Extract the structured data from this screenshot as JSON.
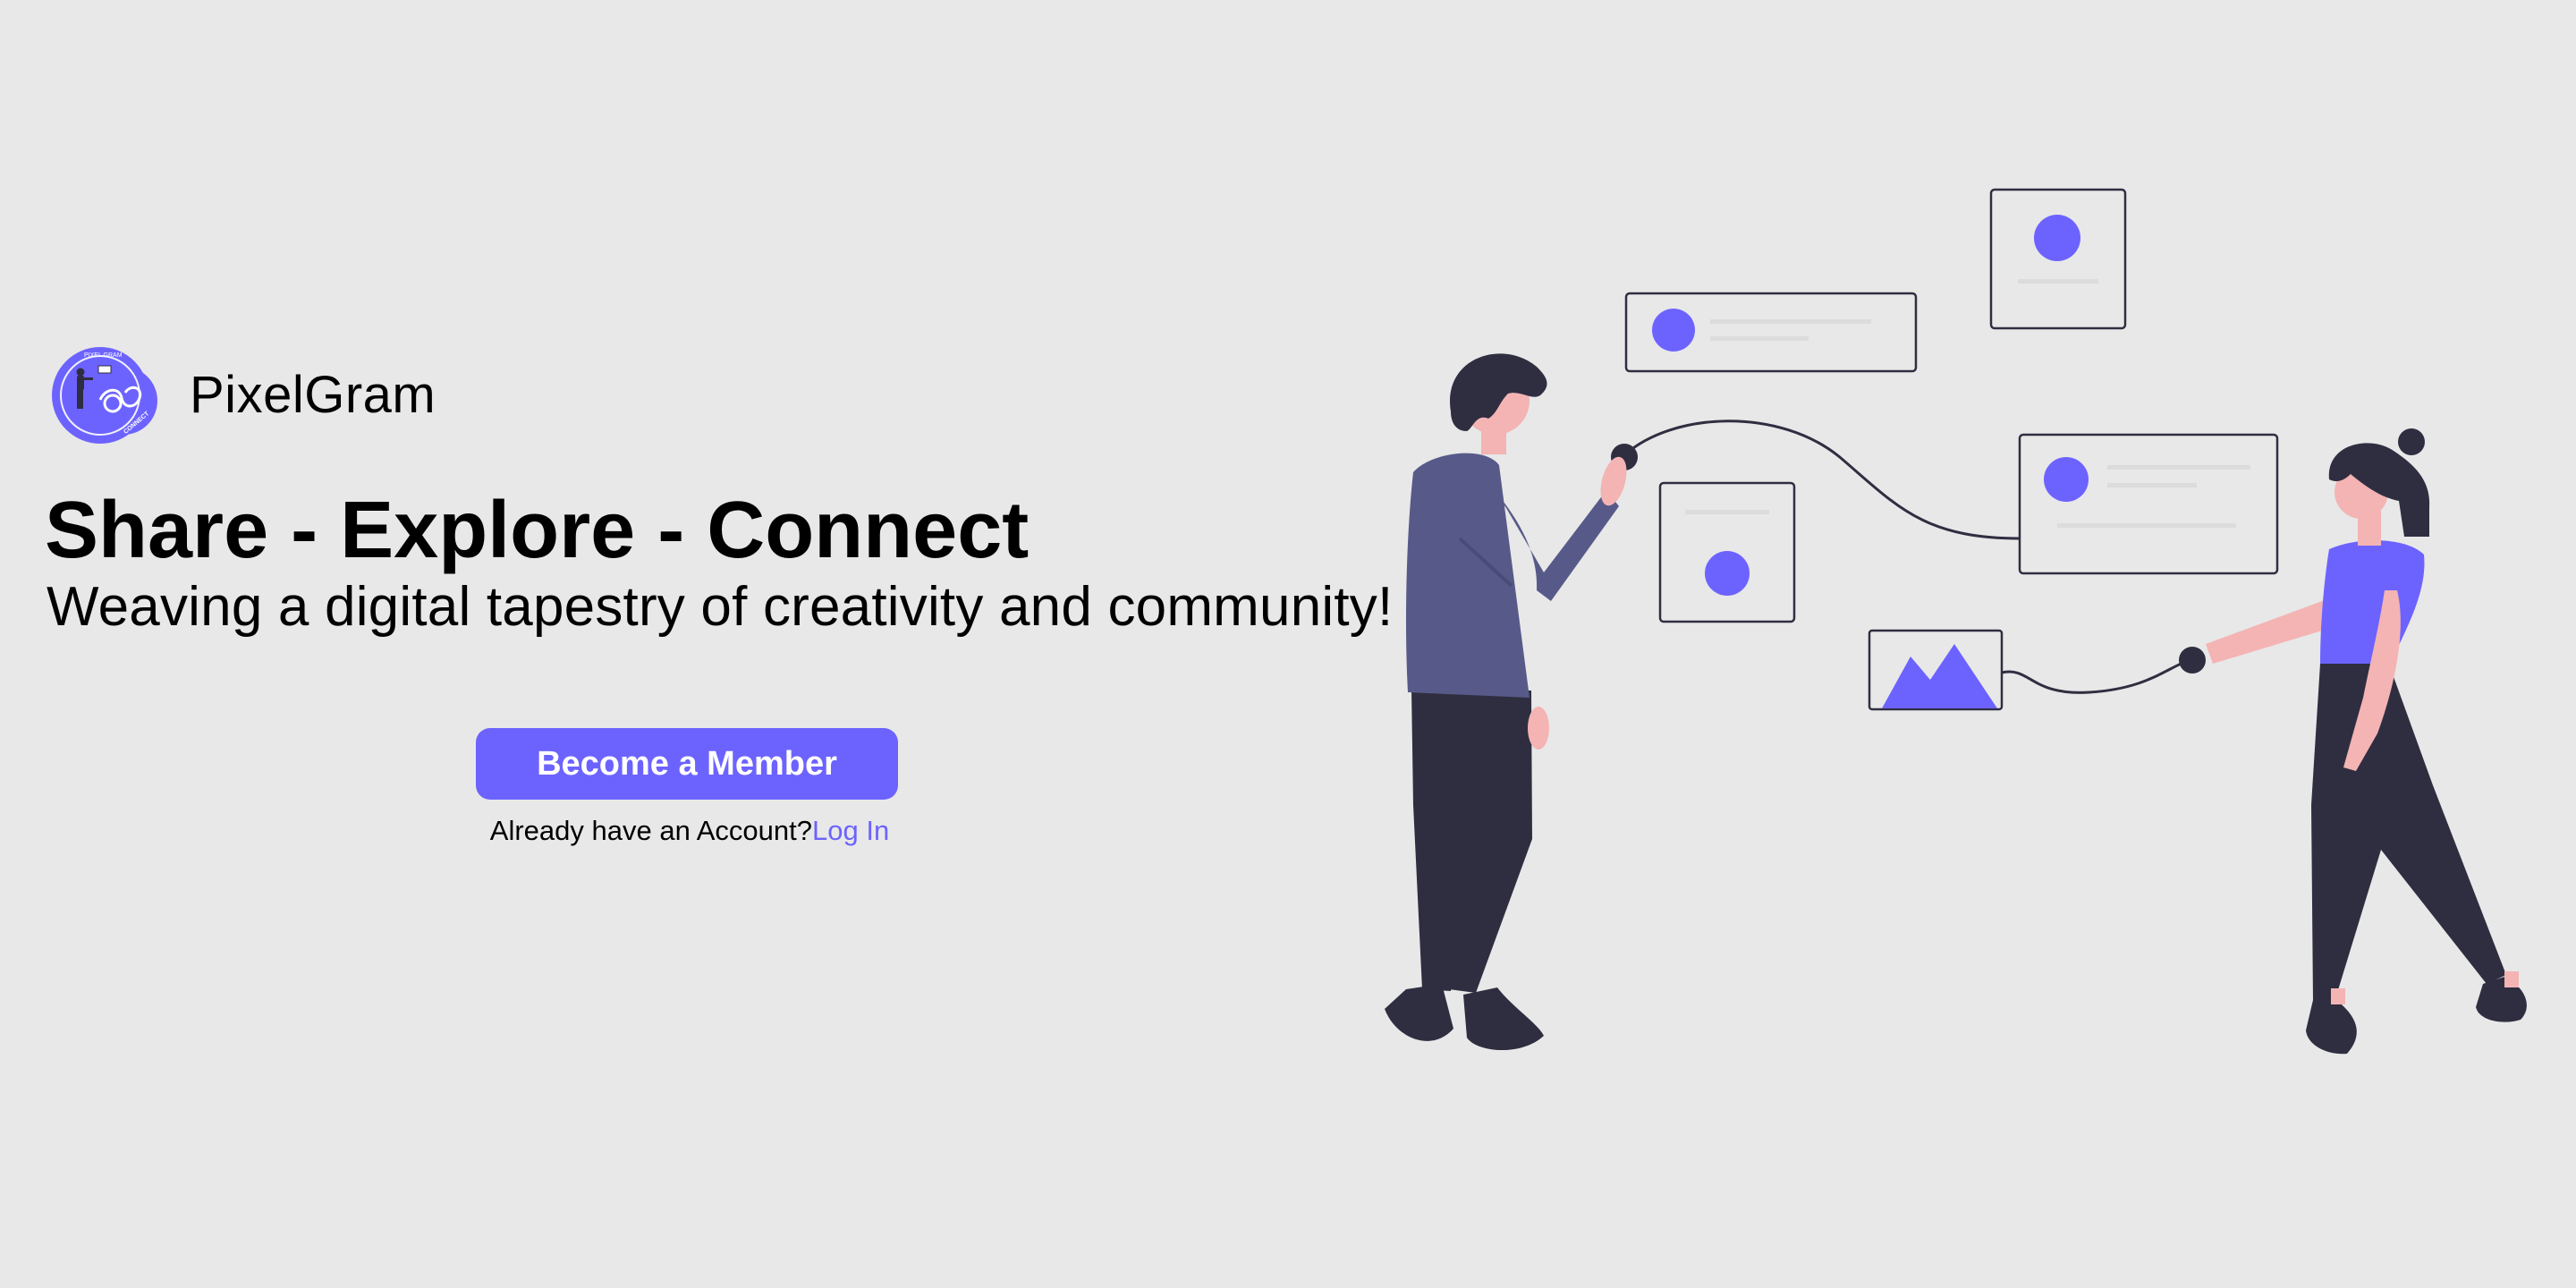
{
  "brand": {
    "name": "PixelGram",
    "logo_icon": "pixelgram-logo-icon",
    "logo_text_top": "PIXEL GRAM",
    "logo_text_side": "CONNECT"
  },
  "hero": {
    "headline": "Share - Explore - Connect",
    "tagline": "Weaving a digital tapestry of creativity and community!"
  },
  "actions": {
    "signup_label": "Become a Member",
    "login_prompt": "Already have an Account?",
    "login_link": "Log In"
  },
  "colors": {
    "background": "#e8e8e8",
    "accent": "#6c63ff",
    "text": "#000000",
    "illustration_dark": "#2f2e41",
    "illustration_shirt": "#575a89",
    "illustration_skin": "#f4b4b4"
  }
}
